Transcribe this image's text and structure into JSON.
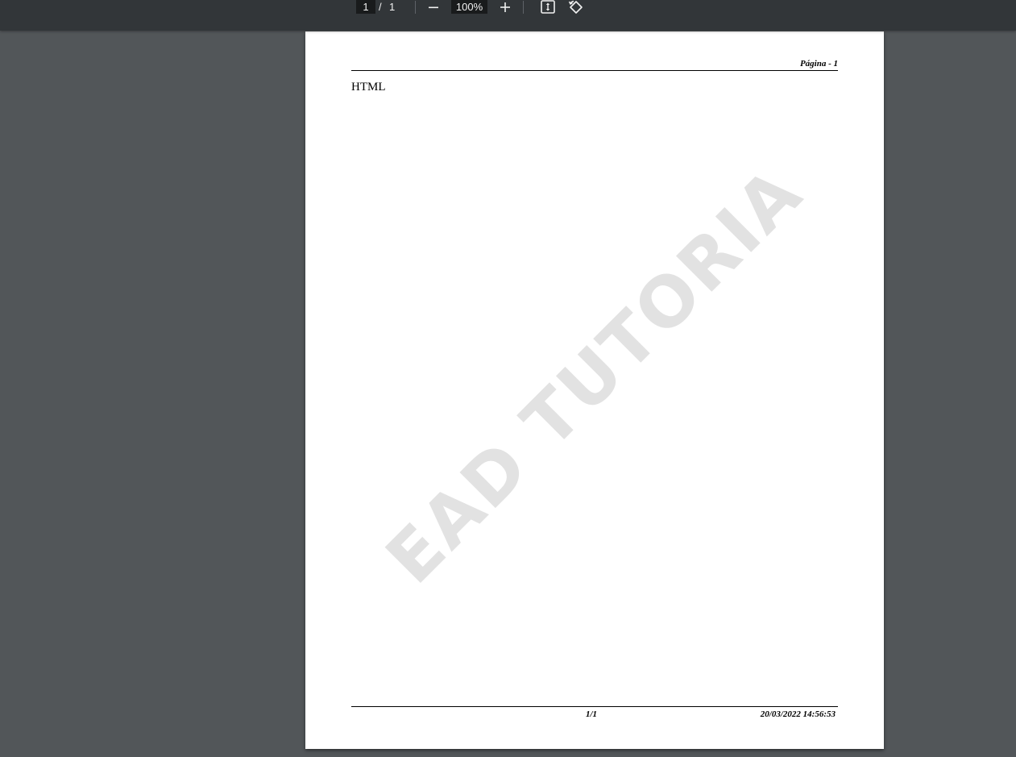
{
  "toolbar": {
    "page_current": "1",
    "page_separator": "/",
    "page_total": "1",
    "zoom_value": "100%",
    "icons": [
      "minus-icon",
      "plus-icon",
      "fit-page-icon",
      "rotate-icon"
    ]
  },
  "document": {
    "header_page": "Página - 1",
    "body_text": "HTML",
    "watermark": "EAD TUTORIA",
    "footer_pages": "1/1",
    "footer_datetime": "20/03/2022 14:56:53"
  }
}
